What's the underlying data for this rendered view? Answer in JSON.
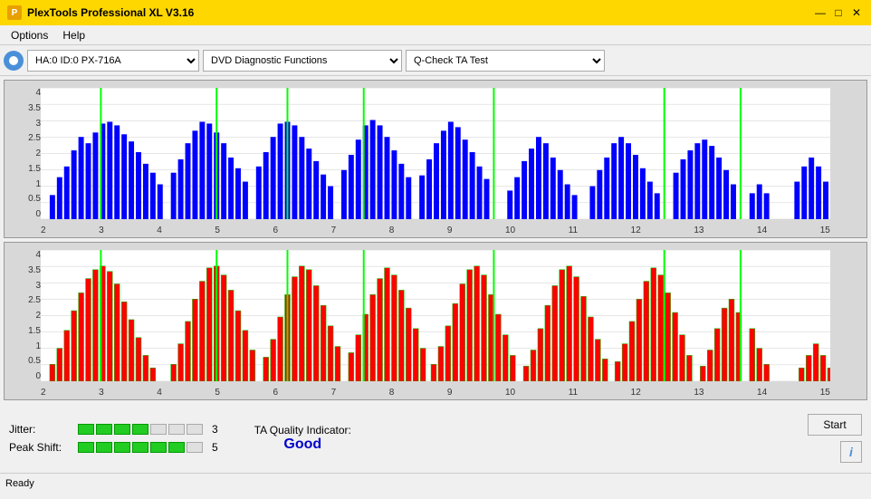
{
  "titleBar": {
    "title": "PlexTools Professional XL V3.16",
    "icon": "P",
    "controls": [
      "—",
      "□",
      "✕"
    ]
  },
  "menu": {
    "items": [
      "Options",
      "Help"
    ]
  },
  "toolbar": {
    "driveLabel": "HA:0 ID:0  PX-716A",
    "functionLabel": "DVD Diagnostic Functions",
    "testLabel": "Q-Check TA Test"
  },
  "charts": {
    "top": {
      "yLabels": [
        "4",
        "3.5",
        "3",
        "2.5",
        "2",
        "1.5",
        "1",
        "0.5",
        "0"
      ],
      "xLabels": [
        "2",
        "3",
        "4",
        "5",
        "6",
        "7",
        "8",
        "9",
        "10",
        "11",
        "12",
        "13",
        "14",
        "15"
      ],
      "color": "blue"
    },
    "bottom": {
      "yLabels": [
        "4",
        "3.5",
        "3",
        "2.5",
        "2",
        "1.5",
        "1",
        "0.5",
        "0"
      ],
      "xLabels": [
        "2",
        "3",
        "4",
        "5",
        "6",
        "7",
        "8",
        "9",
        "10",
        "11",
        "12",
        "13",
        "14",
        "15"
      ],
      "color": "red"
    }
  },
  "metrics": {
    "jitter": {
      "label": "Jitter:",
      "filledSegments": 4,
      "totalSegments": 7,
      "value": "3"
    },
    "peakShift": {
      "label": "Peak Shift:",
      "filledSegments": 6,
      "totalSegments": 7,
      "value": "5"
    },
    "taQuality": {
      "label": "TA Quality Indicator:",
      "value": "Good"
    }
  },
  "buttons": {
    "start": "Start",
    "info": "i"
  },
  "statusBar": {
    "text": "Ready"
  }
}
